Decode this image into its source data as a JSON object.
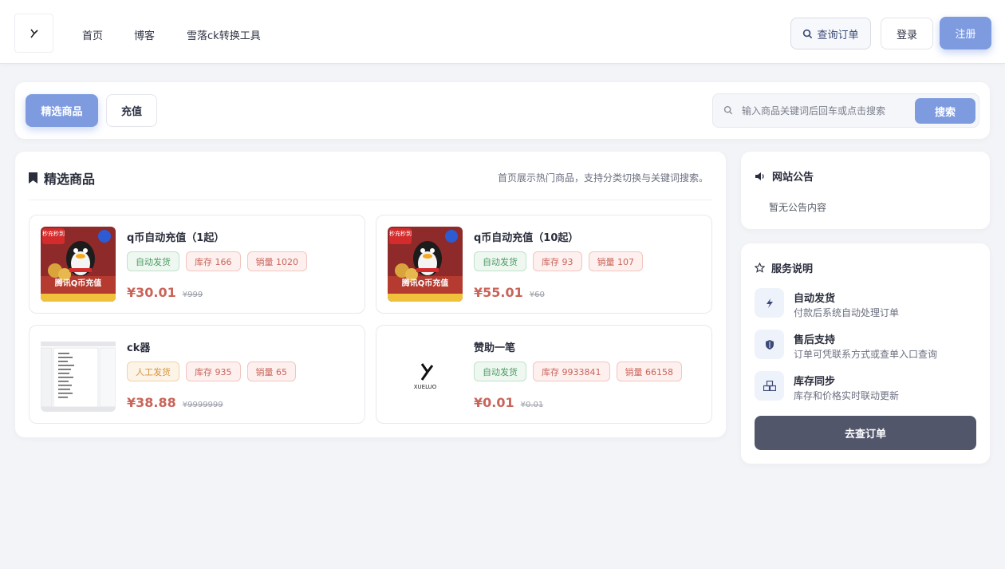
{
  "header": {
    "nav": [
      "首页",
      "博客",
      "雪落ck转换工具"
    ],
    "query_order": "查询订单",
    "login": "登录",
    "register": "注册"
  },
  "tabs": {
    "active": "精选商品",
    "other": "充值"
  },
  "search": {
    "placeholder": "输入商品关键词后回车或点击搜索",
    "button": "搜索"
  },
  "main": {
    "title": "精选商品",
    "subtitle": "首页展示热门商品，支持分类切换与关键词搜索。",
    "products": [
      {
        "name": "q币自动充值（1起）",
        "delivery": "自动发货",
        "stock": "库存 166",
        "sales": "销量 1020",
        "price": "¥30.01",
        "old_price": "¥999",
        "thumb_text": "腾讯Q币充值",
        "thumb_badge": "秒充秒到"
      },
      {
        "name": "q币自动充值（10起）",
        "delivery": "自动发货",
        "stock": "库存 93",
        "sales": "销量 107",
        "price": "¥55.01",
        "old_price": "¥60",
        "thumb_text": "腾讯Q币充值",
        "thumb_badge": "秒充秒到"
      },
      {
        "name": "ck器",
        "delivery": "人工发货",
        "stock": "库存 935",
        "sales": "销量 65",
        "price": "¥38.88",
        "old_price": "¥9999999"
      },
      {
        "name": "赞助一笔",
        "delivery": "自动发货",
        "stock": "库存 9933841",
        "sales": "销量 66158",
        "price": "¥0.01",
        "old_price": "¥0.01",
        "thumb_text": "XUELUO"
      }
    ]
  },
  "notice": {
    "title": "网站公告",
    "text": "暂无公告内容"
  },
  "service": {
    "title": "服务说明",
    "items": [
      {
        "title": "自动发货",
        "desc": "付款后系统自动处理订单"
      },
      {
        "title": "售后支持",
        "desc": "订单可凭联系方式或查单入口查询"
      },
      {
        "title": "库存同步",
        "desc": "库存和价格实时联动更新"
      }
    ],
    "button": "去查订单"
  },
  "colors": {
    "accent": "#7e9be0",
    "price": "#c9645a",
    "dark_button": "#52566b"
  }
}
